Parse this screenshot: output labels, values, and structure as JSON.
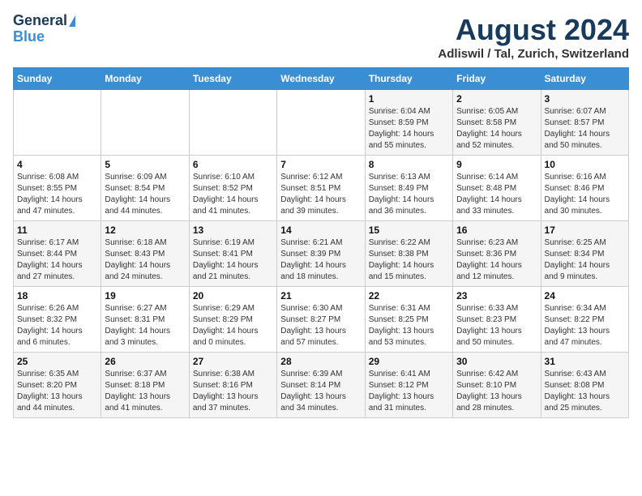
{
  "header": {
    "logo_line1": "General",
    "logo_line2": "Blue",
    "title": "August 2024",
    "subtitle": "Adliswil / Tal, Zurich, Switzerland"
  },
  "days_of_week": [
    "Sunday",
    "Monday",
    "Tuesday",
    "Wednesday",
    "Thursday",
    "Friday",
    "Saturday"
  ],
  "weeks": [
    [
      {
        "day": "",
        "info": ""
      },
      {
        "day": "",
        "info": ""
      },
      {
        "day": "",
        "info": ""
      },
      {
        "day": "",
        "info": ""
      },
      {
        "day": "1",
        "info": "Sunrise: 6:04 AM\nSunset: 8:59 PM\nDaylight: 14 hours\nand 55 minutes."
      },
      {
        "day": "2",
        "info": "Sunrise: 6:05 AM\nSunset: 8:58 PM\nDaylight: 14 hours\nand 52 minutes."
      },
      {
        "day": "3",
        "info": "Sunrise: 6:07 AM\nSunset: 8:57 PM\nDaylight: 14 hours\nand 50 minutes."
      }
    ],
    [
      {
        "day": "4",
        "info": "Sunrise: 6:08 AM\nSunset: 8:55 PM\nDaylight: 14 hours\nand 47 minutes."
      },
      {
        "day": "5",
        "info": "Sunrise: 6:09 AM\nSunset: 8:54 PM\nDaylight: 14 hours\nand 44 minutes."
      },
      {
        "day": "6",
        "info": "Sunrise: 6:10 AM\nSunset: 8:52 PM\nDaylight: 14 hours\nand 41 minutes."
      },
      {
        "day": "7",
        "info": "Sunrise: 6:12 AM\nSunset: 8:51 PM\nDaylight: 14 hours\nand 39 minutes."
      },
      {
        "day": "8",
        "info": "Sunrise: 6:13 AM\nSunset: 8:49 PM\nDaylight: 14 hours\nand 36 minutes."
      },
      {
        "day": "9",
        "info": "Sunrise: 6:14 AM\nSunset: 8:48 PM\nDaylight: 14 hours\nand 33 minutes."
      },
      {
        "day": "10",
        "info": "Sunrise: 6:16 AM\nSunset: 8:46 PM\nDaylight: 14 hours\nand 30 minutes."
      }
    ],
    [
      {
        "day": "11",
        "info": "Sunrise: 6:17 AM\nSunset: 8:44 PM\nDaylight: 14 hours\nand 27 minutes."
      },
      {
        "day": "12",
        "info": "Sunrise: 6:18 AM\nSunset: 8:43 PM\nDaylight: 14 hours\nand 24 minutes."
      },
      {
        "day": "13",
        "info": "Sunrise: 6:19 AM\nSunset: 8:41 PM\nDaylight: 14 hours\nand 21 minutes."
      },
      {
        "day": "14",
        "info": "Sunrise: 6:21 AM\nSunset: 8:39 PM\nDaylight: 14 hours\nand 18 minutes."
      },
      {
        "day": "15",
        "info": "Sunrise: 6:22 AM\nSunset: 8:38 PM\nDaylight: 14 hours\nand 15 minutes."
      },
      {
        "day": "16",
        "info": "Sunrise: 6:23 AM\nSunset: 8:36 PM\nDaylight: 14 hours\nand 12 minutes."
      },
      {
        "day": "17",
        "info": "Sunrise: 6:25 AM\nSunset: 8:34 PM\nDaylight: 14 hours\nand 9 minutes."
      }
    ],
    [
      {
        "day": "18",
        "info": "Sunrise: 6:26 AM\nSunset: 8:32 PM\nDaylight: 14 hours\nand 6 minutes."
      },
      {
        "day": "19",
        "info": "Sunrise: 6:27 AM\nSunset: 8:31 PM\nDaylight: 14 hours\nand 3 minutes."
      },
      {
        "day": "20",
        "info": "Sunrise: 6:29 AM\nSunset: 8:29 PM\nDaylight: 14 hours\nand 0 minutes."
      },
      {
        "day": "21",
        "info": "Sunrise: 6:30 AM\nSunset: 8:27 PM\nDaylight: 13 hours\nand 57 minutes."
      },
      {
        "day": "22",
        "info": "Sunrise: 6:31 AM\nSunset: 8:25 PM\nDaylight: 13 hours\nand 53 minutes."
      },
      {
        "day": "23",
        "info": "Sunrise: 6:33 AM\nSunset: 8:23 PM\nDaylight: 13 hours\nand 50 minutes."
      },
      {
        "day": "24",
        "info": "Sunrise: 6:34 AM\nSunset: 8:22 PM\nDaylight: 13 hours\nand 47 minutes."
      }
    ],
    [
      {
        "day": "25",
        "info": "Sunrise: 6:35 AM\nSunset: 8:20 PM\nDaylight: 13 hours\nand 44 minutes."
      },
      {
        "day": "26",
        "info": "Sunrise: 6:37 AM\nSunset: 8:18 PM\nDaylight: 13 hours\nand 41 minutes."
      },
      {
        "day": "27",
        "info": "Sunrise: 6:38 AM\nSunset: 8:16 PM\nDaylight: 13 hours\nand 37 minutes."
      },
      {
        "day": "28",
        "info": "Sunrise: 6:39 AM\nSunset: 8:14 PM\nDaylight: 13 hours\nand 34 minutes."
      },
      {
        "day": "29",
        "info": "Sunrise: 6:41 AM\nSunset: 8:12 PM\nDaylight: 13 hours\nand 31 minutes."
      },
      {
        "day": "30",
        "info": "Sunrise: 6:42 AM\nSunset: 8:10 PM\nDaylight: 13 hours\nand 28 minutes."
      },
      {
        "day": "31",
        "info": "Sunrise: 6:43 AM\nSunset: 8:08 PM\nDaylight: 13 hours\nand 25 minutes."
      }
    ]
  ]
}
